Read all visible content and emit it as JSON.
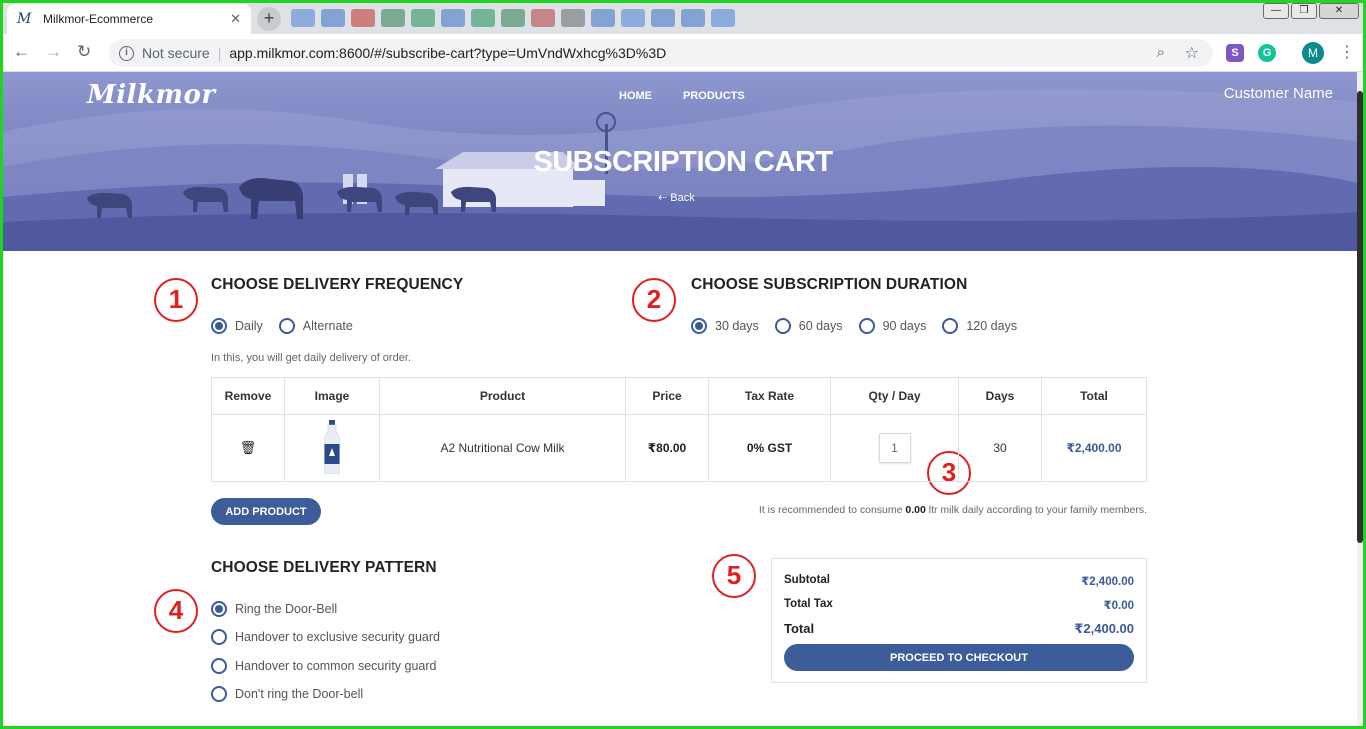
{
  "browser": {
    "tab_title": "Milkmor-Ecommerce",
    "tab_favicon": "M",
    "tab_close": "✕",
    "new_tab": "+",
    "security_label": "Not secure",
    "url": "app.milkmor.com:8600/#/subscribe-cart?type=UmVndWxhcg%3D%3D",
    "profile_initial": "M",
    "ext_s": "S",
    "ext_g": "G"
  },
  "header": {
    "logo": "Milkmor",
    "nav": [
      "HOME",
      "PRODUCTS"
    ],
    "customer_name": "Customer Name",
    "title": "SUBSCRIPTION CART",
    "back_label": "Back"
  },
  "frequency": {
    "title": "CHOOSE DELIVERY FREQUENCY",
    "options": [
      {
        "label": "Daily",
        "selected": true
      },
      {
        "label": "Alternate",
        "selected": false
      }
    ],
    "note": "In this, you will get daily delivery of order."
  },
  "duration": {
    "title": "CHOOSE SUBSCRIPTION DURATION",
    "options": [
      {
        "label": "30 days",
        "selected": true
      },
      {
        "label": "60 days",
        "selected": false
      },
      {
        "label": "90 days",
        "selected": false
      },
      {
        "label": "120 days",
        "selected": false
      }
    ]
  },
  "cart": {
    "headers": [
      "Remove",
      "Image",
      "Product",
      "Price",
      "Tax Rate",
      "Qty / Day",
      "Days",
      "Total"
    ],
    "rows": [
      {
        "product": "A2 Nutritional Cow Milk",
        "price": "₹80.00",
        "tax_rate": "0% GST",
        "qty": "1",
        "days": "30",
        "total": "₹2,400.00"
      }
    ]
  },
  "add_product_label": "ADD PRODUCT",
  "recommendation": {
    "prefix": "It is recommended to consume",
    "amount": "0.00",
    "suffix": "ltr milk daily according to your family members."
  },
  "pattern": {
    "title": "CHOOSE DELIVERY PATTERN",
    "options": [
      {
        "label": "Ring the Door-Bell",
        "selected": true
      },
      {
        "label": "Handover to exclusive security guard",
        "selected": false
      },
      {
        "label": "Handover to common security guard",
        "selected": false
      },
      {
        "label": "Don't ring the Door-bell",
        "selected": false
      }
    ]
  },
  "summary": {
    "subtotal_label": "Subtotal",
    "subtotal": "₹2,400.00",
    "tax_label": "Total Tax",
    "tax": "₹0.00",
    "total_label": "Total",
    "total": "₹2,400.00",
    "checkout_label": "PROCEED TO CHECKOUT"
  },
  "annotations": [
    "1",
    "2",
    "3",
    "4",
    "5"
  ],
  "colors": {
    "accent": "#3c5d9a",
    "annotation": "#e02020",
    "hero": "#7b83c1",
    "frame": "#22d322"
  }
}
